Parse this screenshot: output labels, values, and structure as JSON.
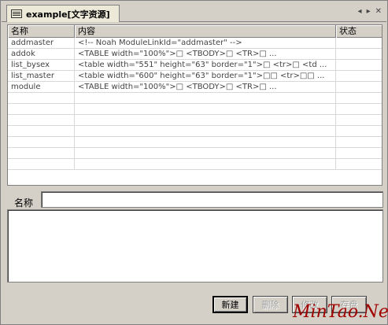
{
  "tab": {
    "title": "example[文字资源]",
    "controls": [
      "◂",
      "▸",
      "✕"
    ]
  },
  "table": {
    "columns": [
      "名称",
      "内容",
      "状态"
    ],
    "rows": [
      {
        "name": "addmaster",
        "content": "<!-- Noah ModuleLinkId=\"addmaster\" -->",
        "status": ""
      },
      {
        "name": "addok",
        "content": "<TABLE width=\"100%\">□          <TBODY>□          <TR>□               ...",
        "status": ""
      },
      {
        "name": "list_bysex",
        "content": "<table width=\"551\" height=\"63\" border=\"1\">□   <tr>□     <td ...",
        "status": ""
      },
      {
        "name": "list_master",
        "content": "<table width=\"600\" height=\"63\" border=\"1\">□□   <tr>□□      ...",
        "status": ""
      },
      {
        "name": "module",
        "content": "<TABLE width=\"100%\">□          <TBODY>□          <TR>□               ...",
        "status": ""
      }
    ],
    "empty_rows": 7
  },
  "form": {
    "name_label": "名称",
    "name_value": "",
    "content_value": ""
  },
  "buttons": {
    "new": "新建",
    "delete": "删除",
    "modify": "修改",
    "save": "存盘"
  },
  "watermark": "MinTao.Net"
}
